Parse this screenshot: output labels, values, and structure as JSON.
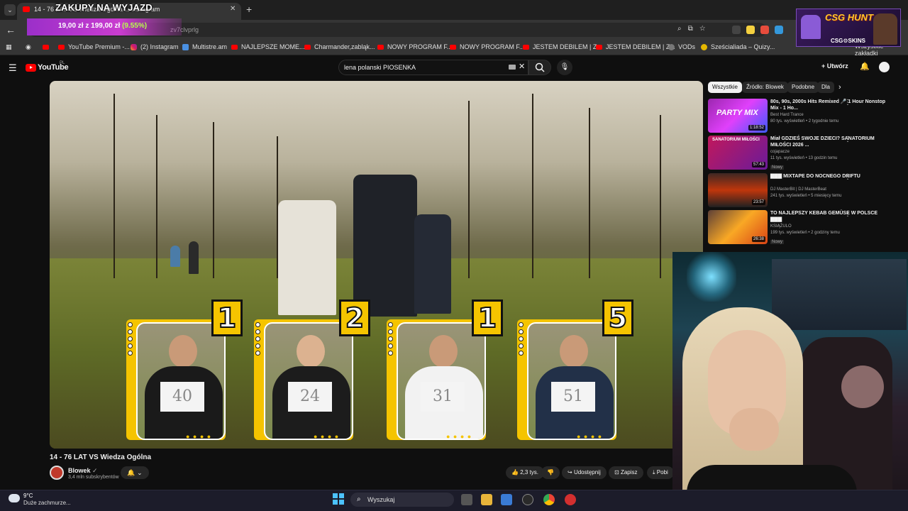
{
  "browser": {
    "tab_title": "14 - 76 LAT VS Wiedza Ogólna ... Instagram",
    "overlay_title": "ZAKUPY NA WYJAZD",
    "url": "zv7clvprlg",
    "promo_price": "19,00 zł z 199,00 zł",
    "promo_pct": "(9.55%)",
    "bookmarks": [
      "YouTube Premium -...",
      "(2) Instagram",
      "Multistre.am",
      "NAJLEPSZE MOME...",
      "Charmander,zabląk...",
      "NOWY PROGRAM F...",
      "NOWY PROGRAM F...",
      "JESTEM DEBILEM | Z...",
      "JESTEM DEBILEM | Z...",
      "VODs",
      "Sześcialiada – Quizy..."
    ],
    "all_bookmarks": "Wszystkie zakładki"
  },
  "csg_banner": {
    "title": "CSG HUNT",
    "subtitle": "CSG⚙SKINS"
  },
  "youtube": {
    "logo": "YouTube",
    "logo_region": "PL",
    "search_value": "lena polanski PIOSENKA",
    "create_label": "Utwórz"
  },
  "video": {
    "title": "14 - 76 LAT VS Wiedza Ogólna",
    "cards": [
      {
        "badge": "1",
        "paper": "40"
      },
      {
        "badge": "2",
        "paper": "24"
      },
      {
        "badge": "1",
        "paper": "31"
      },
      {
        "badge": "5",
        "paper": "51"
      }
    ]
  },
  "channel": {
    "name": "Blowek",
    "subscribers": "3,4 mln subskrybentów"
  },
  "actions": {
    "likes": "2,3 tys.",
    "share": "Udostępnij",
    "save": "Zapisz",
    "download": "Pobi"
  },
  "sidebar": {
    "chips": [
      "Wszystkie",
      "Źródło: Blowek",
      "Podobne",
      "Dla"
    ],
    "recommendations": [
      {
        "title": "80s, 90s, 2000s Hits Remixed 🎤 1 Hour Nonstop Mix - 1 Ho...",
        "channel": "Best Hard Trance",
        "meta": "80 tys. wyświetleń • 2 tygodnie temu",
        "duration": "1:18:52",
        "badge": ""
      },
      {
        "title": "Miał GDZIEŚ SWOJE DZIECI? SANATORIUM MIŁOŚCI 2026 ...",
        "channel": "cojapacze",
        "meta": "11 tys. wyświetleń • 13 godzin temu",
        "duration": "57:43",
        "badge": "Nowy"
      },
      {
        "title": "▇▇▇ MIXTAPE DO NOCNEGO DRIFTU",
        "channel": "DJ MasterBit | DJ MasterBeat",
        "meta": "241 tys. wyświetleń • 5 miesięcy temu",
        "duration": "23:57",
        "badge": ""
      },
      {
        "title": "TO NAJLEPSZY KEBAB GEMÜSE W POLSCE ▇▇▇",
        "channel": "KSIĄŻULO",
        "meta": "199 tys. wyświetleń • 2 godziny temu",
        "duration": "26:38",
        "badge": "Nowy"
      }
    ]
  },
  "taskbar": {
    "temperature": "9°C",
    "weather": "Duże zachmurze...",
    "search_placeholder": "Wyszukaj"
  }
}
